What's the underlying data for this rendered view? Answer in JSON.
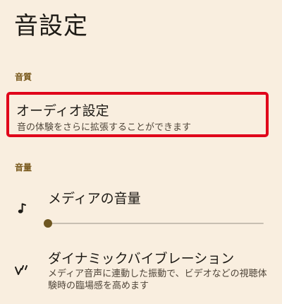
{
  "page": {
    "title": "音設定"
  },
  "sections": {
    "quality_header": "音質",
    "volume_header": "音量"
  },
  "audio_settings": {
    "title": "オーディオ設定",
    "summary": "音の体験をさらに拡張することができます"
  },
  "media_volume": {
    "title": "メディアの音量",
    "level_fraction": 0.0
  },
  "dynamic_vibration": {
    "title": "ダイナミックバイブレーション",
    "summary": "メディア音声に連動した振動で、ビデオなどの視聴体験時の臨場感を高めます"
  },
  "icons": {
    "volume_icon": "music-note-icon",
    "vibration_icon": "dynamic-vibration-icon"
  },
  "colors": {
    "background": "#f9eedf",
    "accent": "#6e5620",
    "section_header": "#7a5a1e",
    "highlight_border": "#e0001a"
  }
}
